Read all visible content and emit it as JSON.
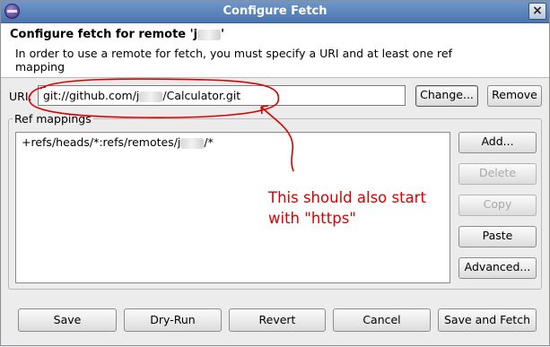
{
  "window": {
    "title": "Configure Fetch"
  },
  "header": {
    "title_prefix": "Configure fetch for remote 'j",
    "title_suffix": "'",
    "description": "In order to use a remote for fetch, you must specify a URI and at least one ref mapping"
  },
  "uri": {
    "label": "URI:",
    "value_prefix": "git://github.com/j",
    "value_suffix": "/Calculator.git",
    "change_label": "Change...",
    "remove_label": "Remove"
  },
  "ref_mappings": {
    "group_label": "Ref mappings",
    "items": [
      {
        "prefix": "+refs/heads/*:refs/remotes/j",
        "suffix": "/*"
      }
    ],
    "buttons": {
      "add": "Add...",
      "delete": "Delete",
      "copy": "Copy",
      "paste": "Paste",
      "advanced": "Advanced..."
    }
  },
  "annotation": {
    "line1": "This should also start",
    "line2": "with \"https\"",
    "color": "#d90000"
  },
  "footer": {
    "save": "Save",
    "dry_run": "Dry-Run",
    "revert": "Revert",
    "cancel": "Cancel",
    "save_and_fetch": "Save and Fetch"
  },
  "icons": {
    "window_icon": "eclipse-icon",
    "close": "close-icon"
  }
}
